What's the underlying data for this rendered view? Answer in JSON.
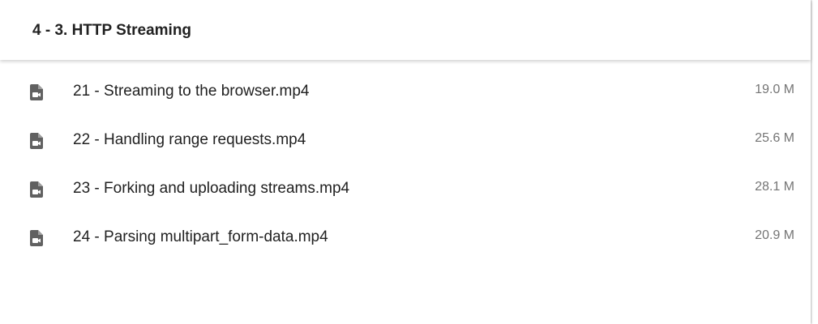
{
  "folder": {
    "title": "4 - 3. HTTP Streaming"
  },
  "files": [
    {
      "name": "21 - Streaming to the browser.mp4",
      "size": "19.0 M",
      "icon": "video-file-icon"
    },
    {
      "name": "22 - Handling range requests.mp4",
      "size": "25.6 M",
      "icon": "video-file-icon"
    },
    {
      "name": "23 - Forking and uploading streams.mp4",
      "size": "28.1 M",
      "icon": "video-file-icon"
    },
    {
      "name": "24 - Parsing multipart_form-data.mp4",
      "size": "20.9 M",
      "icon": "video-file-icon"
    }
  ],
  "colors": {
    "icon": "#616161",
    "text": "#212121",
    "secondary_text": "#757575"
  }
}
